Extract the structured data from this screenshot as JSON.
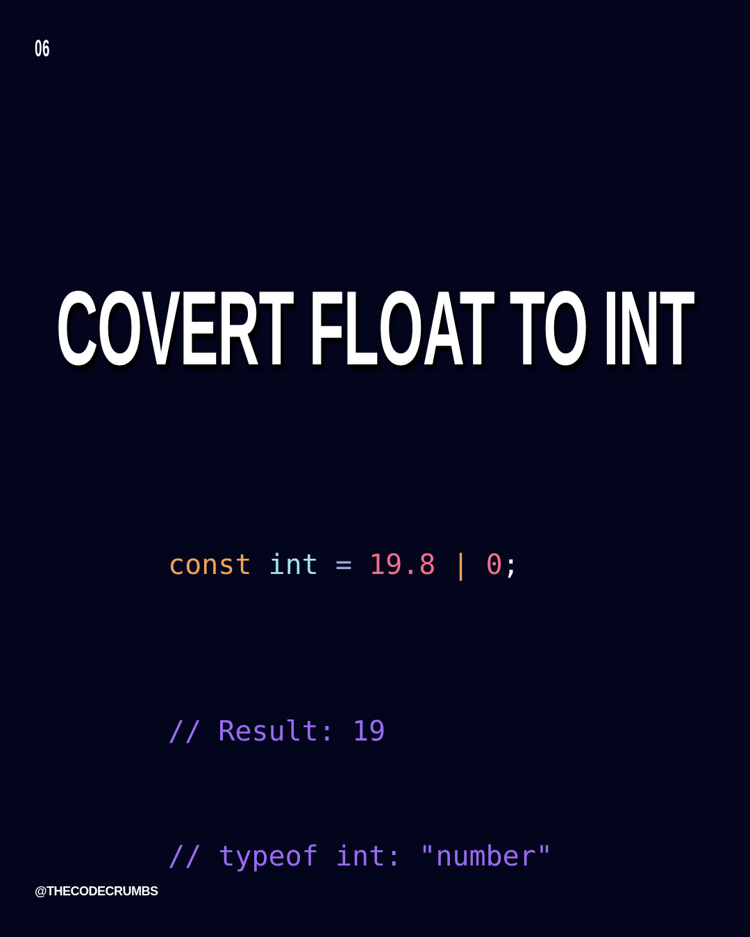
{
  "slide_number": "06",
  "title": "COVERT FLOAT TO INT",
  "code": {
    "line1": {
      "keyword": "const",
      "identifier": "int",
      "operator": "=",
      "number": "19.8",
      "pipe": "|",
      "zero": "0",
      "semicolon": ";"
    },
    "comment1": "// Result: 19",
    "comment2": "// typeof int: \"number\""
  },
  "handle": "@THECODECRUMBS",
  "colors": {
    "background": "#03051c",
    "keyword": "#eea35a",
    "identifier": "#a8e2ea",
    "number": "#f0708c",
    "comment": "#9a6cf0"
  }
}
